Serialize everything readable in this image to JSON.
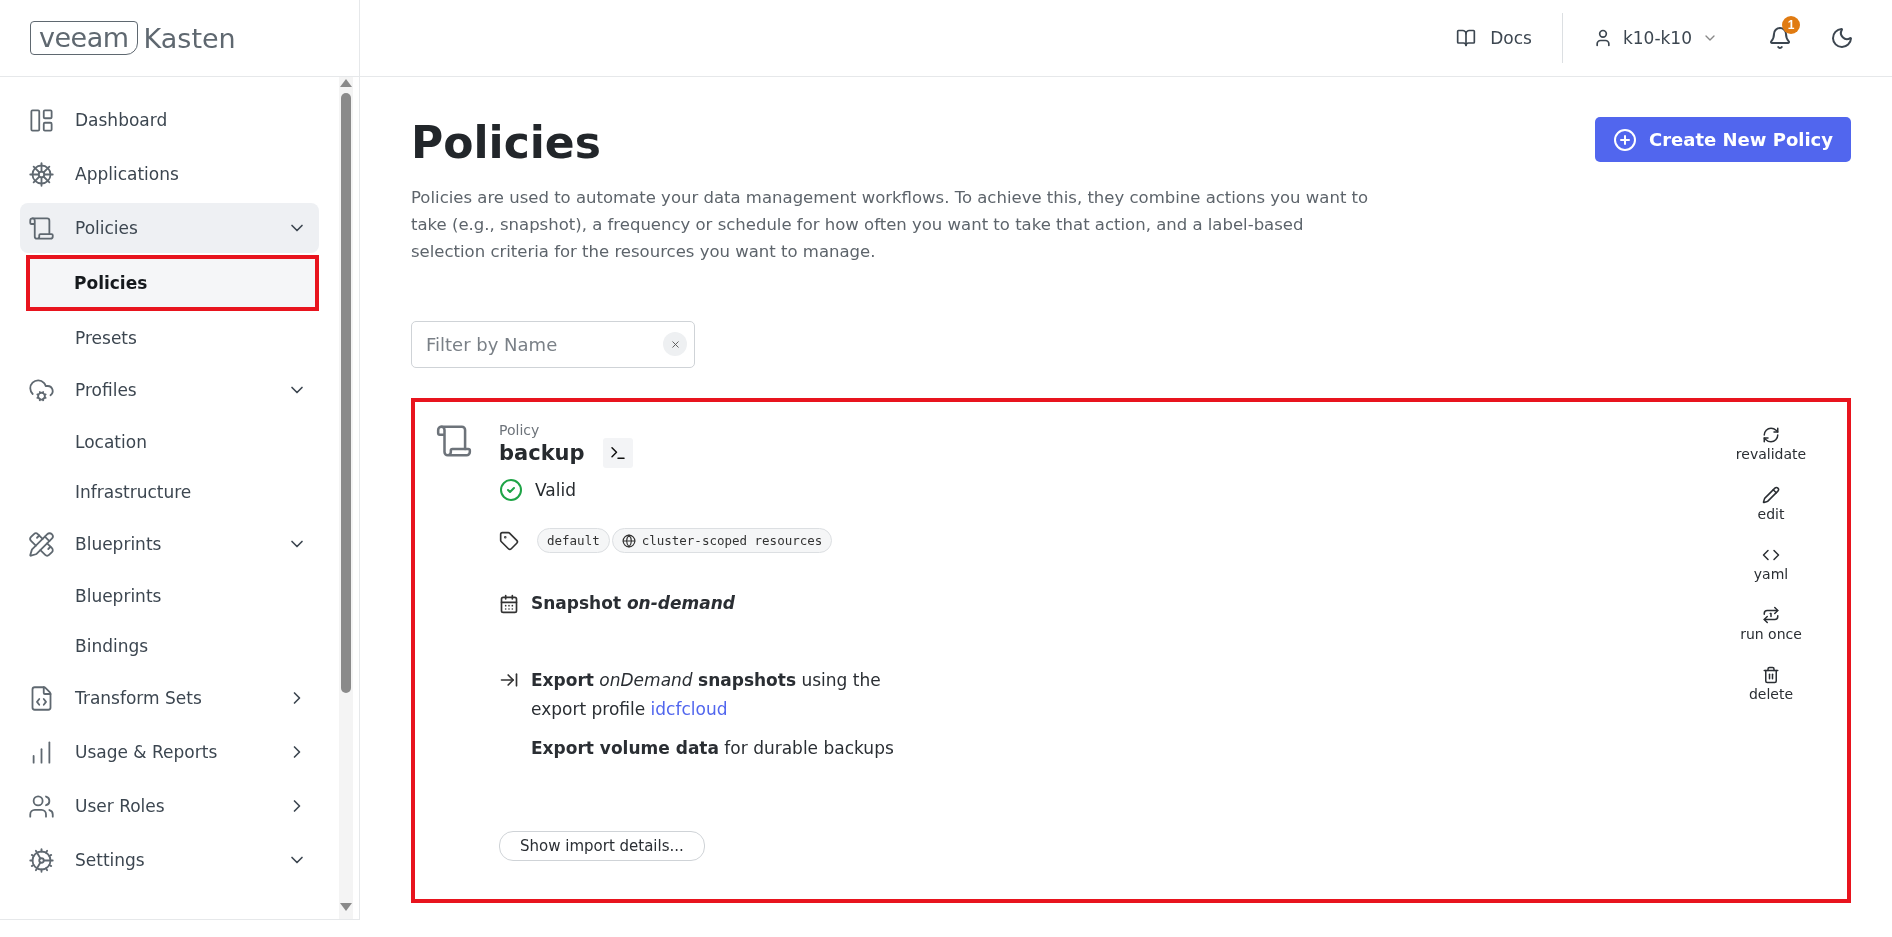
{
  "logo": {
    "brand": "veeam",
    "product": "Kasten"
  },
  "header": {
    "docs": "Docs",
    "user": "k10-k10",
    "notifications": "1"
  },
  "sidebar": {
    "items": [
      {
        "label": "Dashboard",
        "selected": false
      },
      {
        "label": "Applications",
        "selected": false
      },
      {
        "label": "Policies",
        "selected": true,
        "expanded": true,
        "children": [
          {
            "label": "Policies",
            "selected": true,
            "highlighted": true
          },
          {
            "label": "Presets",
            "selected": false,
            "highlighted": false
          }
        ]
      },
      {
        "label": "Profiles",
        "selected": false,
        "expanded": true,
        "children": [
          {
            "label": "Location",
            "selected": false,
            "highlighted": false
          },
          {
            "label": "Infrastructure",
            "selected": false,
            "highlighted": false
          }
        ]
      },
      {
        "label": "Blueprints",
        "selected": false,
        "expanded": true,
        "children": [
          {
            "label": "Blueprints",
            "selected": false,
            "highlighted": false
          },
          {
            "label": "Bindings",
            "selected": false,
            "highlighted": false
          }
        ]
      },
      {
        "label": "Transform Sets",
        "selected": false,
        "expanded": false
      },
      {
        "label": "Usage & Reports",
        "selected": false,
        "expanded": false
      },
      {
        "label": "User Roles",
        "selected": false,
        "expanded": false
      },
      {
        "label": "Settings",
        "selected": false,
        "expanded": true
      }
    ]
  },
  "page": {
    "title": "Policies",
    "description": "Policies are used to automate your data management workflows. To achieve this, they combine actions you want to take (e.g., snapshot), a frequency or schedule for how often you want to take that action, and a label-based selection criteria for the resources you want to manage.",
    "create_button": "Create New Policy"
  },
  "filter": {
    "placeholder": "Filter by Name"
  },
  "policy": {
    "highlighted": true,
    "type_label": "Policy",
    "name": "backup",
    "status": "Valid",
    "tags": [
      {
        "label": "default",
        "kind": "plain"
      },
      {
        "label": "cluster-scoped resources",
        "kind": "global"
      }
    ],
    "actions": [
      {
        "kind": "snapshot",
        "text": "Snapshot *on-demand*"
      },
      {
        "kind": "export",
        "text": "**Export** *onDemand* **snapshots** using the export profile",
        "link": "idcfcloud",
        "detail": "**Export volume data** for durable backups"
      }
    ],
    "import_button": "Show import details...",
    "buttons": [
      "revalidate",
      "edit",
      "yaml",
      "run once",
      "delete"
    ]
  }
}
